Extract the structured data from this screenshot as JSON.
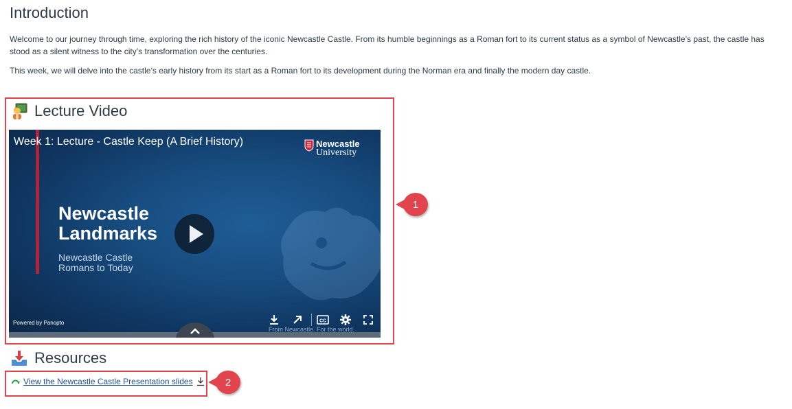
{
  "intro": {
    "heading": "Introduction",
    "paragraph1": "Welcome to our journey through time, exploring the rich history of the iconic Newcastle Castle. From its humble beginnings as a Roman fort to its current status as a symbol of Newcastle’s past, the castle has stood as a silent witness to the city’s transformation over the centuries.",
    "paragraph2": "This week, we will delve into the castle’s early history from its start as a Roman fort to its development during the Norman era and finally the modern day castle."
  },
  "lecture": {
    "heading": "Lecture Video",
    "icon": "teacher-emoji-icon",
    "video": {
      "title": "Week 1: Lecture - Castle Keep (A Brief History)",
      "logo_line1": "Newcastle",
      "logo_line2": "University",
      "slide_title_line1": "Newcastle",
      "slide_title_line2": "Landmarks",
      "slide_sub_line1": "Newcastle Castle",
      "slide_sub_line2": "Romans to Today",
      "powered_by": "Powered by Panopto",
      "tagline": "From Newcastle. For the world.",
      "controls": [
        "download-icon",
        "open-external-icon",
        "closed-captions-icon",
        "settings-gear-icon",
        "fullscreen-icon"
      ]
    }
  },
  "resources": {
    "heading": "Resources",
    "icon": "download-tray-icon",
    "link_text": "View the Newcastle Castle Presentation slides"
  },
  "callouts": {
    "one": "1",
    "two": "2"
  },
  "colors": {
    "callout_red": "#e1444c",
    "link_blue": "#1f4f8e",
    "video_blue": "#174d80",
    "accent_red": "#b0243b"
  }
}
